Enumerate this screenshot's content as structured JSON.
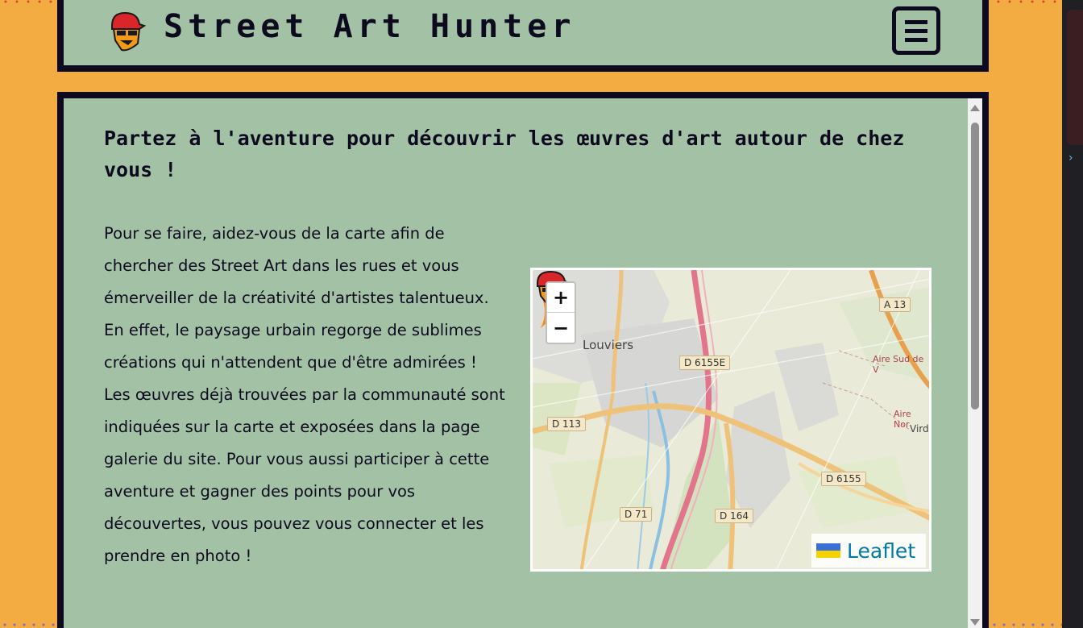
{
  "header": {
    "title": "Street Art Hunter",
    "logo_icon": "hunter-mascot-logo",
    "menu_icon": "hamburger-menu-icon"
  },
  "main": {
    "heading": "Partez à l'aventure pour découvrir les œuvres d'art autour de chez vous !",
    "paragraph_1": "Pour se faire, aidez-vous de la carte afin de chercher des Street Art dans les rues et vous émerveiller de la créativité d'artistes talentueux.",
    "paragraph_2": "En effet, le paysage urbain regorge de sublimes créations qui n'attendent que d'être admirées ! Les œuvres déjà trouvées par la communauté sont indiquées sur la carte et exposées dans la page galerie du site. Pour vous aussi participer à cette aventure et gagner des points pour vos découvertes, vous pouvez vous connecter et les prendre en photo !"
  },
  "map": {
    "zoom_in": "+",
    "zoom_out": "−",
    "attribution": "Leaflet",
    "town": "Louviers",
    "town_2": "Vird",
    "labels": {
      "d6155e": "D 6155E",
      "a13": "A 13",
      "d113": "D 113",
      "d6155": "D 6155",
      "d71": "D 71",
      "d164": "D 164"
    },
    "red_labels": {
      "aire_sud": "Aire Sud de V",
      "aire_nord": "Aire Nor"
    },
    "marker_icon": "street-art-marker-icon"
  },
  "colors": {
    "background": "#f3ac42",
    "panel": "#a3c2a5",
    "border": "#0d0a20",
    "link": "#0078a8"
  }
}
